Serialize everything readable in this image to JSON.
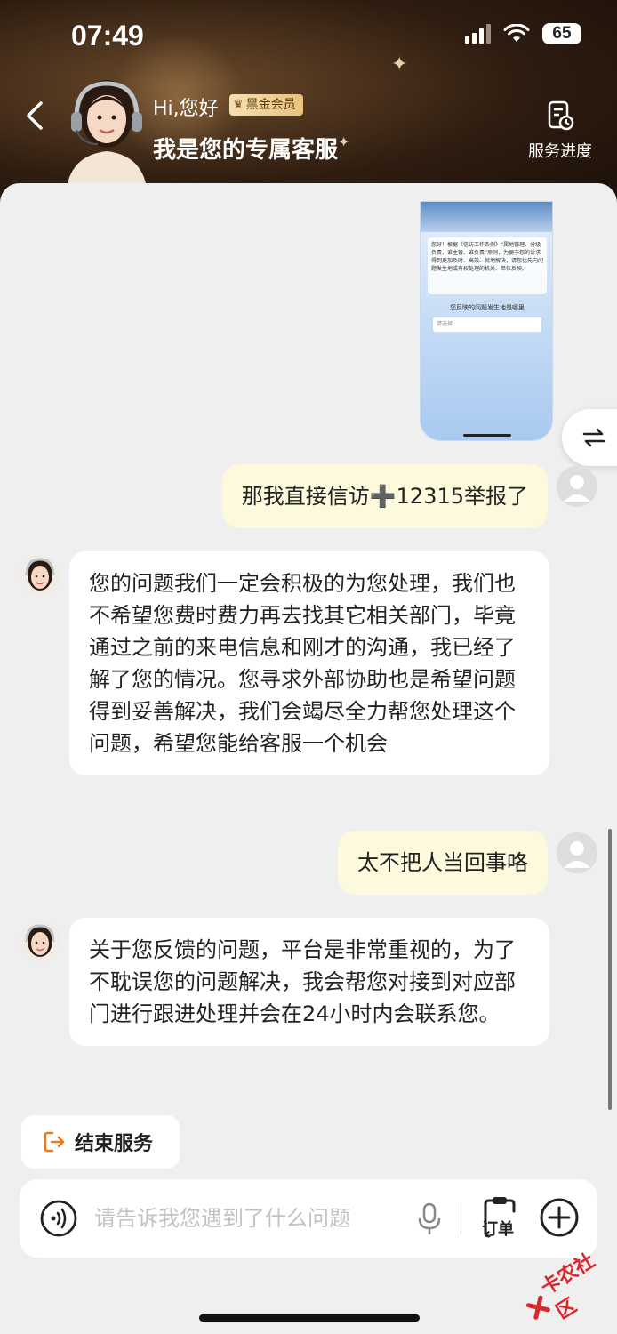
{
  "status_bar": {
    "time": "07:49",
    "battery": "65"
  },
  "header": {
    "greeting": "Hi,您好",
    "badge": "黑金会员",
    "title": "我是您的专属客服",
    "progress_label": "服务进度"
  },
  "shared_screenshot": {
    "notice": "您好！根据《信访工作条例》“属地管理、分级负责，谁主管、谁负责”原则，为便于您的诉求得到更加及时、高效、就地解决，请您优先向问题发生地或有权处理的机关、单位反映。",
    "question": "您反映的问题发生地是哪里",
    "select_placeholder": "请选择"
  },
  "messages": [
    {
      "from": "user",
      "text": "那我直接信访➕12315举报了"
    },
    {
      "from": "agent",
      "text": "您的问题我们一定会积极的为您处理，我们也不希望您费时费力再去找其它相关部门，毕竟通过之前的来电信息和刚才的沟通，我已经了解了您的情况。您寻求外部协助也是希望问题得到妥善解决，我们会竭尽全力帮您处理这个问题，希望您能给客服一个机会"
    },
    {
      "from": "user",
      "text": "太不把人当回事咯"
    },
    {
      "from": "agent",
      "text": "关于您反馈的问题，平台是非常重视的，为了不耽误您的问题解决，我会帮您对接到对应部门进行跟进处理并会在24小时内会联系您。"
    }
  ],
  "actions": {
    "end_service": "结束服务"
  },
  "input": {
    "placeholder": "请告诉我您遇到了什么问题",
    "order_label": "订单"
  },
  "watermark": "卡农社区",
  "colors": {
    "user_bubble": "#fcf9dc",
    "agent_bubble": "#ffffff",
    "accent_orange": "#f07a1a",
    "header_brown": "#2e1c10"
  },
  "icons": [
    "back-arrow-icon",
    "service-progress-icon",
    "swap-icon",
    "exit-icon",
    "voice-wave-icon",
    "microphone-icon",
    "order-icon",
    "plus-icon"
  ]
}
